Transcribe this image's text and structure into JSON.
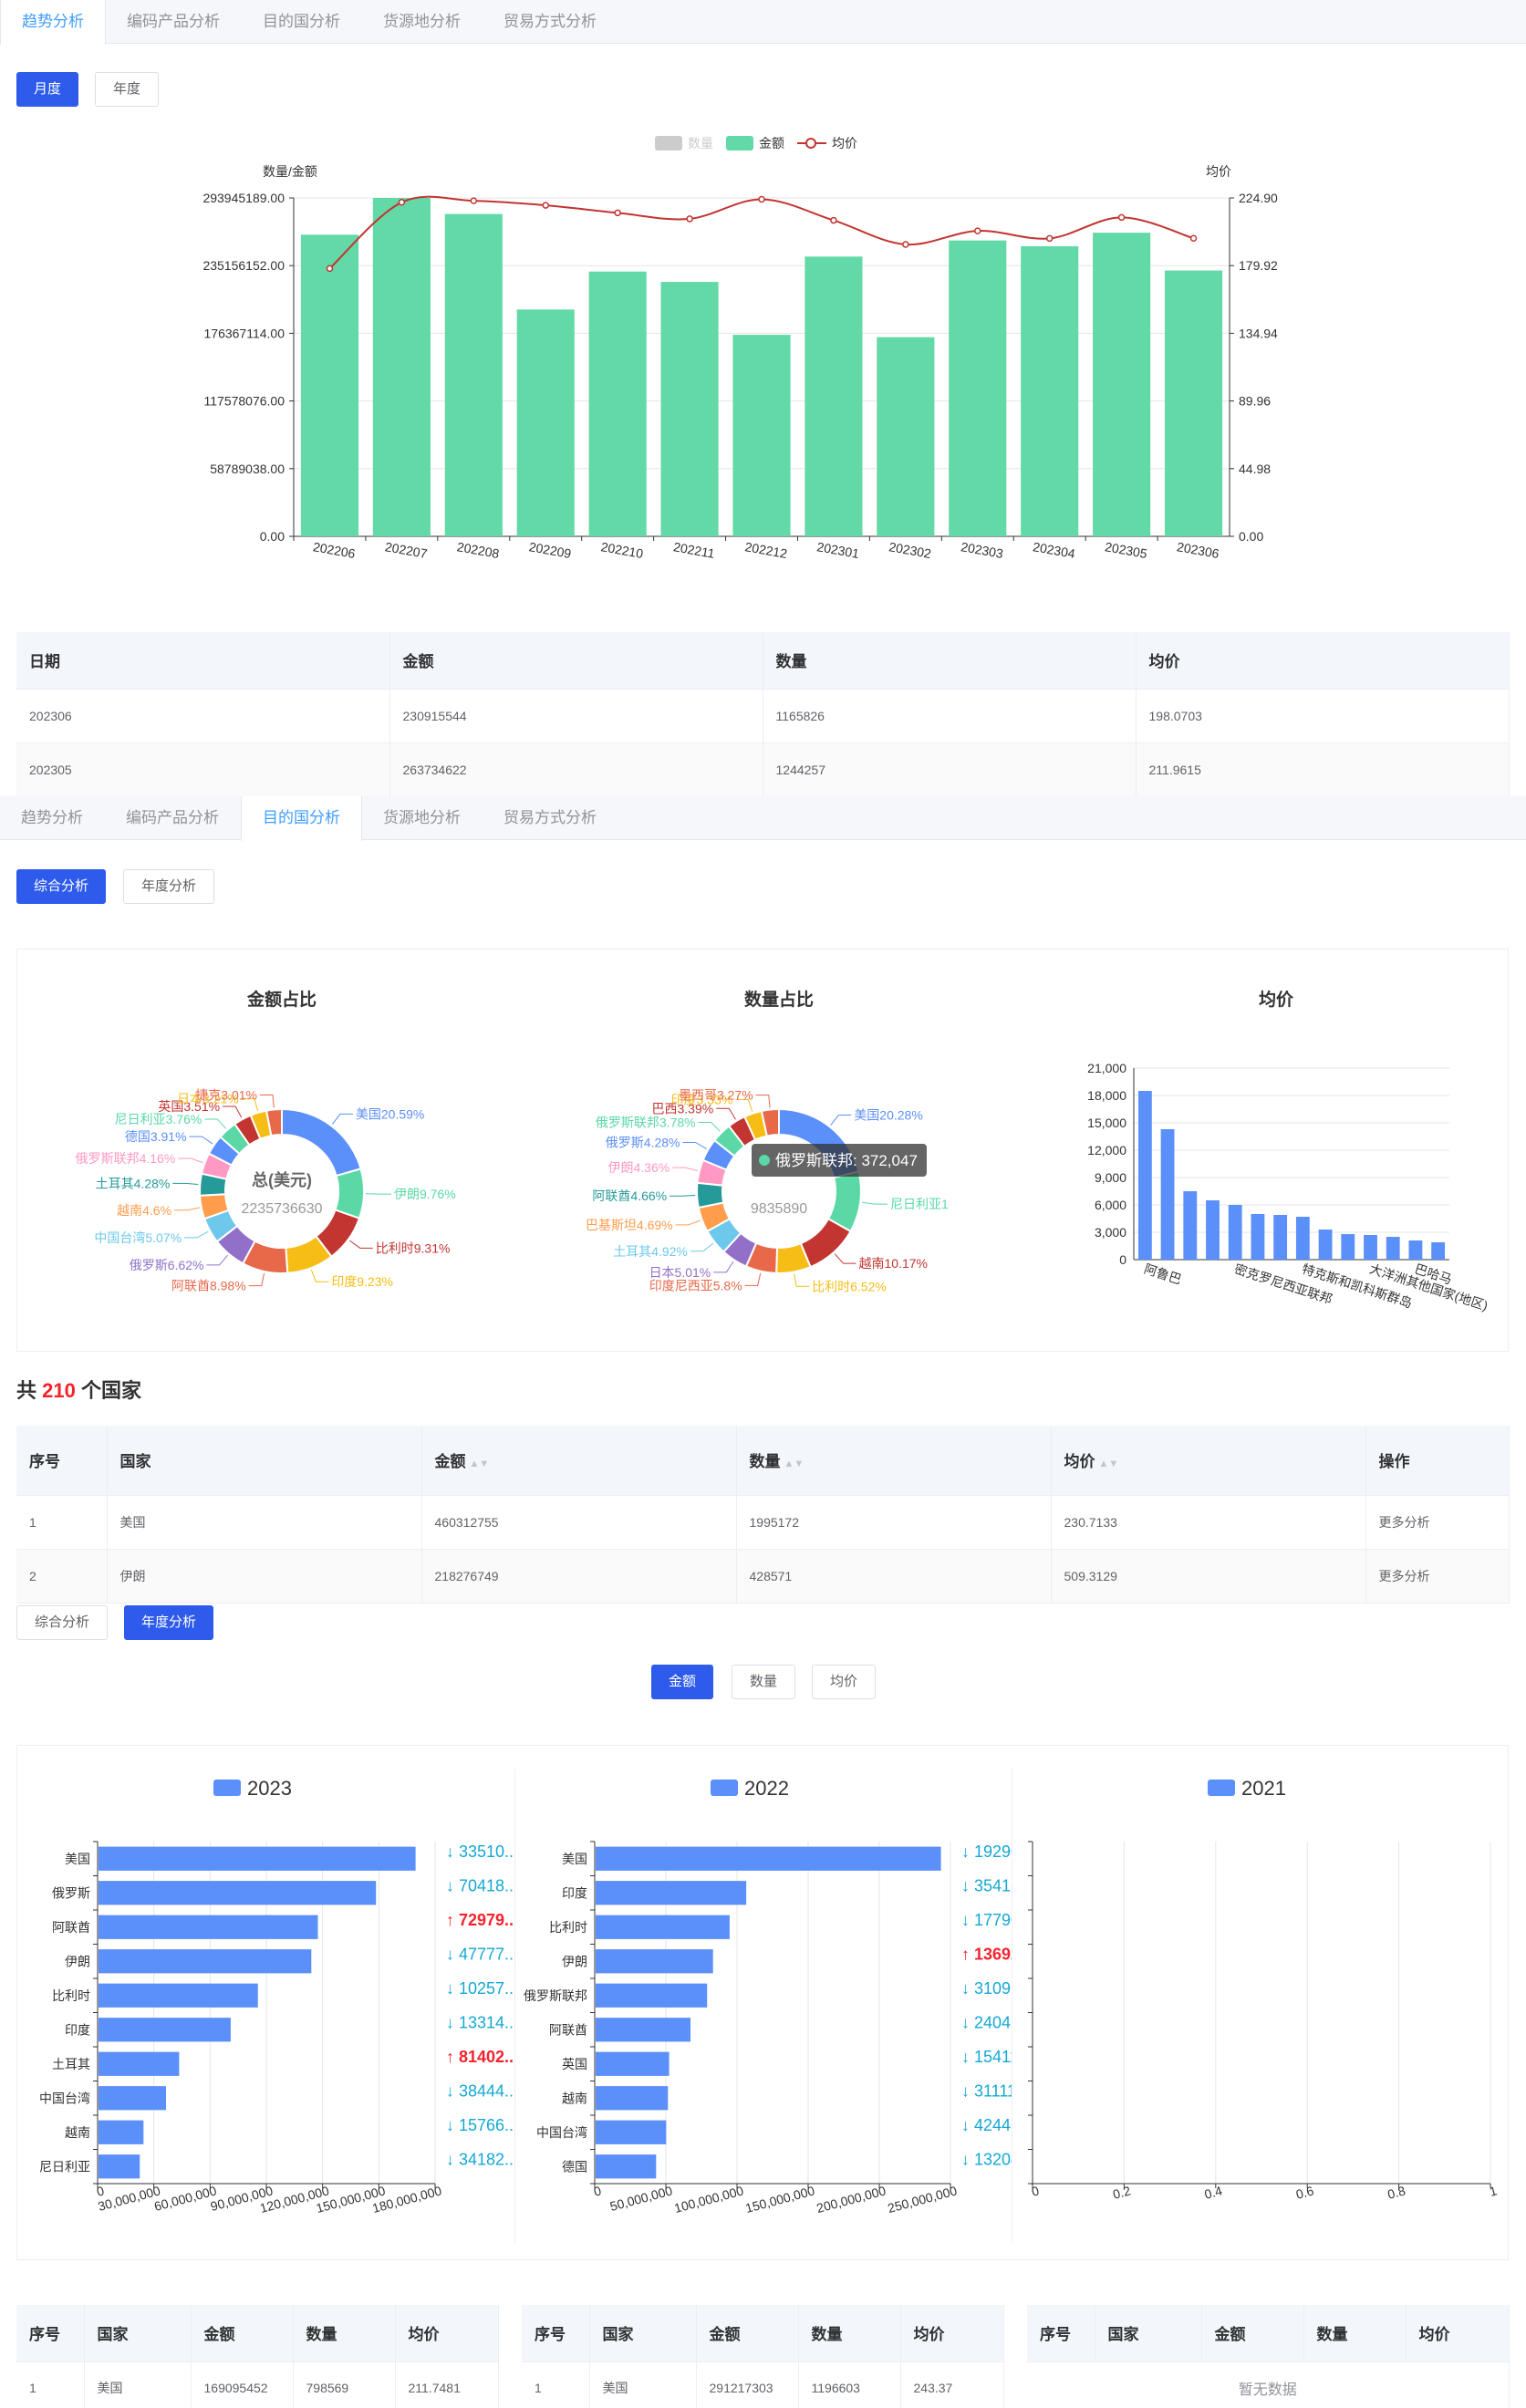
{
  "tabs": [
    "趋势分析",
    "编码产品分析",
    "目的国分析",
    "货源地分析",
    "贸易方式分析"
  ],
  "trend": {
    "active_tab": 0,
    "period_buttons": [
      "月度",
      "年度"
    ],
    "legend": [
      "数量",
      "金额",
      "均价"
    ],
    "y_left_name": "数量/金额",
    "y_right_name": "均价",
    "chart_data": {
      "type": "bar",
      "categories": [
        "202206",
        "202207",
        "202208",
        "202209",
        "202210",
        "202211",
        "202212",
        "202301",
        "202302",
        "202303",
        "202304",
        "202305",
        "202306"
      ],
      "series": [
        {
          "name": "金额",
          "type": "bar",
          "values": [
            262000000,
            293945189,
            280000000,
            197000000,
            230000000,
            221000000,
            175000000,
            243000000,
            173000000,
            257000000,
            252000000,
            263734622,
            230915544
          ]
        },
        {
          "name": "均价",
          "type": "line",
          "values": [
            178,
            222,
            223,
            220,
            215,
            211,
            224,
            210,
            194,
            203,
            198,
            211.9615,
            198.0703
          ]
        }
      ],
      "y_left_ticks": [
        "0.00",
        "58789038.00",
        "117578076.00",
        "176367114.00",
        "235156152.00",
        "293945189.00"
      ],
      "y_right_ticks": [
        "0.00",
        "44.98",
        "89.96",
        "134.94",
        "179.92",
        "224.90"
      ],
      "ylim_left": [
        0,
        293945189
      ],
      "ylim_right": [
        0,
        224.9
      ],
      "bar_color": "#62d9a7",
      "line_color": "#c23531"
    },
    "table": {
      "headers": [
        "日期",
        "金额",
        "数量",
        "均价"
      ],
      "rows": [
        [
          "202306",
          "230915544",
          "1165826",
          "198.0703"
        ],
        [
          "202305",
          "263734622",
          "1244257",
          "211.9615"
        ]
      ]
    }
  },
  "dest": {
    "active_tab": 2,
    "mode_buttons": [
      "综合分析",
      "年度分析"
    ],
    "amount_title": "金额占比",
    "qty_title": "数量占比",
    "avg_title": "均价",
    "donut_amount": {
      "center_label": "总(美元)",
      "center_value": "2235736630",
      "chart_data": {
        "type": "pie",
        "slices": [
          {
            "label": "美国20.59%",
            "value": 20.59,
            "color": "#5b8ff9"
          },
          {
            "label": "伊朗9.76%",
            "value": 9.76,
            "color": "#5ad8a6"
          },
          {
            "label": "比利时9.31%",
            "value": 9.31,
            "color": "#c23531"
          },
          {
            "label": "印度9.23%",
            "value": 9.23,
            "color": "#f6bd16"
          },
          {
            "label": "阿联酋8.98%",
            "value": 8.98,
            "color": "#e8684a"
          },
          {
            "label": "俄罗斯6.62%",
            "value": 6.62,
            "color": "#9270ca"
          },
          {
            "label": "中国台湾5.07%",
            "value": 5.07,
            "color": "#6dc8ec"
          },
          {
            "label": "越南4.6%",
            "value": 4.6,
            "color": "#ff9d4d"
          },
          {
            "label": "土耳其4.28%",
            "value": 4.28,
            "color": "#269a99"
          },
          {
            "label": "俄罗斯联邦4.16%",
            "value": 4.16,
            "color": "#ff99c3"
          },
          {
            "label": "德国3.91%",
            "value": 3.91,
            "color": "#5b8ff9"
          },
          {
            "label": "尼日利亚3.76%",
            "value": 3.76,
            "color": "#5ad8a6"
          },
          {
            "label": "英国3.51%",
            "value": 3.51,
            "color": "#c23531"
          },
          {
            "label": "日本3.21%",
            "value": 3.21,
            "color": "#f6bd16"
          },
          {
            "label": "捷克3.01%",
            "value": 3.01,
            "color": "#e8684a"
          }
        ]
      }
    },
    "donut_qty": {
      "tooltip": "俄罗斯联邦: 372,047",
      "center_value": "9835890",
      "chart_data": {
        "type": "pie",
        "slices": [
          {
            "label": "美国20.28%",
            "value": 20.28,
            "color": "#5b8ff9"
          },
          {
            "label": "尼日利亚1",
            "value": 11.5,
            "color": "#5ad8a6"
          },
          {
            "label": "越南10.17%",
            "value": 10.17,
            "color": "#c23531"
          },
          {
            "label": "比利时6.52%",
            "value": 6.52,
            "color": "#f6bd16"
          },
          {
            "label": "印度尼西亚5.8%",
            "value": 5.8,
            "color": "#e8684a"
          },
          {
            "label": "日本5.01%",
            "value": 5.01,
            "color": "#9270ca"
          },
          {
            "label": "土耳其4.92%",
            "value": 4.92,
            "color": "#6dc8ec"
          },
          {
            "label": "巴基斯坦4.69%",
            "value": 4.69,
            "color": "#ff9d4d"
          },
          {
            "label": "阿联酋4.66%",
            "value": 4.66,
            "color": "#269a99"
          },
          {
            "label": "伊朗4.36%",
            "value": 4.36,
            "color": "#ff99c3"
          },
          {
            "label": "俄罗斯4.28%",
            "value": 4.28,
            "color": "#5b8ff9"
          },
          {
            "label": "俄罗斯联邦3.78%",
            "value": 3.78,
            "color": "#5ad8a6"
          },
          {
            "label": "巴西3.39%",
            "value": 3.39,
            "color": "#c23531"
          },
          {
            "label": "印度3.33%",
            "value": 3.33,
            "color": "#f6bd16"
          },
          {
            "label": "墨西哥3.27%",
            "value": 3.27,
            "color": "#e8684a"
          }
        ]
      }
    },
    "avg_chart": {
      "chart_data": {
        "type": "bar",
        "categories": [
          "阿鲁巴",
          "",
          "",
          "",
          "密克罗尼西亚联邦",
          "",
          "",
          "特克斯和凯科斯群岛",
          "",
          "",
          "大洋洲其他国家(地区)",
          "",
          "巴哈马",
          ""
        ],
        "values": [
          18500,
          14300,
          7500,
          6500,
          6000,
          5000,
          4900,
          4700,
          3300,
          2800,
          2700,
          2500,
          2100,
          1900
        ],
        "y_ticks": [
          "0",
          "3,000",
          "6,000",
          "9,000",
          "12,000",
          "15,000",
          "18,000",
          "21,000"
        ],
        "ylim": [
          0,
          21000
        ],
        "color": "#5b8ff9"
      }
    },
    "count_prefix": "共",
    "count_value": "210",
    "count_suffix": "个国家",
    "table": {
      "headers": [
        "序号",
        "国家",
        "金额",
        "数量",
        "均价",
        "操作"
      ],
      "rows": [
        [
          "1",
          "美国",
          "460312755",
          "1995172",
          "230.7133",
          "更多分析"
        ],
        [
          "2",
          "伊朗",
          "218276749",
          "428571",
          "509.3129",
          "更多分析"
        ]
      ]
    }
  },
  "yearly": {
    "mode_buttons": [
      "综合分析",
      "年度分析"
    ],
    "metric_buttons": [
      "金额",
      "数量",
      "均价"
    ],
    "panels": [
      {
        "year": "2023",
        "chart_data": {
          "type": "bar",
          "orientation": "horizontal",
          "categories": [
            "美国",
            "俄罗斯",
            "阿联酋",
            "伊朗",
            "比利时",
            "印度",
            "土耳其",
            "中国台湾",
            "越南",
            "尼日利亚"
          ],
          "values": [
            169095452,
            148000000,
            117000000,
            113500000,
            85000000,
            70500000,
            43000000,
            36000000,
            24000000,
            22000000
          ],
          "x_ticks": [
            "0",
            "30,000,000",
            "60,000,000",
            "90,000,000",
            "120,000,000",
            "150,000,000",
            "180,000,000"
          ],
          "xlim": [
            0,
            180000000
          ],
          "color": "#5b8ff9"
        },
        "ranks": [
          {
            "dir": "↓",
            "text": "33510..",
            "up": false
          },
          {
            "dir": "↓",
            "text": "70418..",
            "up": false
          },
          {
            "dir": "↑",
            "text": "72979..",
            "up": true
          },
          {
            "dir": "↓",
            "text": "47777..",
            "up": false
          },
          {
            "dir": "↓",
            "text": "10257..",
            "up": false
          },
          {
            "dir": "↓",
            "text": "13314..",
            "up": false
          },
          {
            "dir": "↑",
            "text": "81402..",
            "up": true
          },
          {
            "dir": "↓",
            "text": "38444..",
            "up": false
          },
          {
            "dir": "↓",
            "text": "15766..",
            "up": false
          },
          {
            "dir": "↓",
            "text": "34182..",
            "up": false
          }
        ]
      },
      {
        "year": "2022",
        "chart_data": {
          "type": "bar",
          "orientation": "horizontal",
          "categories": [
            "美国",
            "印度",
            "比利时",
            "伊朗",
            "俄罗斯联邦",
            "阿联酋",
            "英国",
            "越南",
            "中国台湾",
            "德国"
          ],
          "values": [
            291217303,
            127000000,
            113000000,
            99000000,
            94000000,
            80000000,
            62000000,
            61000000,
            59500000,
            51000000
          ],
          "x_ticks": [
            "0",
            "50,000,000",
            "100,000,000",
            "150,000,000",
            "200,000,000",
            "250,000,000"
          ],
          "xlim": [
            0,
            300000000
          ],
          "color": "#5b8ff9"
        },
        "ranks": [
          {
            "dir": "↓",
            "text": "19290..",
            "up": false
          },
          {
            "dir": "↓",
            "text": "35418..",
            "up": false
          },
          {
            "dir": "↓",
            "text": "17790..",
            "up": false
          },
          {
            "dir": "↑",
            "text": "13692..",
            "up": true
          },
          {
            "dir": "↓",
            "text": "31091..",
            "up": false
          },
          {
            "dir": "↓",
            "text": "24041..",
            "up": false
          },
          {
            "dir": "↓",
            "text": "15411..",
            "up": false
          },
          {
            "dir": "↓",
            "text": "31111..",
            "up": false
          },
          {
            "dir": "↓",
            "text": "42441..",
            "up": false
          },
          {
            "dir": "↓",
            "text": "13204..",
            "up": false
          }
        ]
      },
      {
        "year": "2021",
        "chart_data": {
          "type": "bar",
          "orientation": "horizontal",
          "categories": [],
          "values": [],
          "x_ticks": [
            "0",
            "0.2",
            "0.4",
            "0.6",
            "0.8",
            "1"
          ],
          "xlim": [
            0,
            1
          ],
          "color": "#5b8ff9"
        },
        "ranks": []
      }
    ],
    "tables": [
      {
        "headers": [
          "序号",
          "国家",
          "金额",
          "数量",
          "均价"
        ],
        "rows": [
          [
            "1",
            "美国",
            "169095452",
            "798569",
            "211.7481"
          ]
        ],
        "empty": ""
      },
      {
        "headers": [
          "序号",
          "国家",
          "金额",
          "数量",
          "均价"
        ],
        "rows": [
          [
            "1",
            "美国",
            "291217303",
            "1196603",
            "243.37"
          ]
        ],
        "empty": ""
      },
      {
        "headers": [
          "序号",
          "国家",
          "金额",
          "数量",
          "均价"
        ],
        "rows": [],
        "empty": "暂无数据"
      }
    ]
  }
}
